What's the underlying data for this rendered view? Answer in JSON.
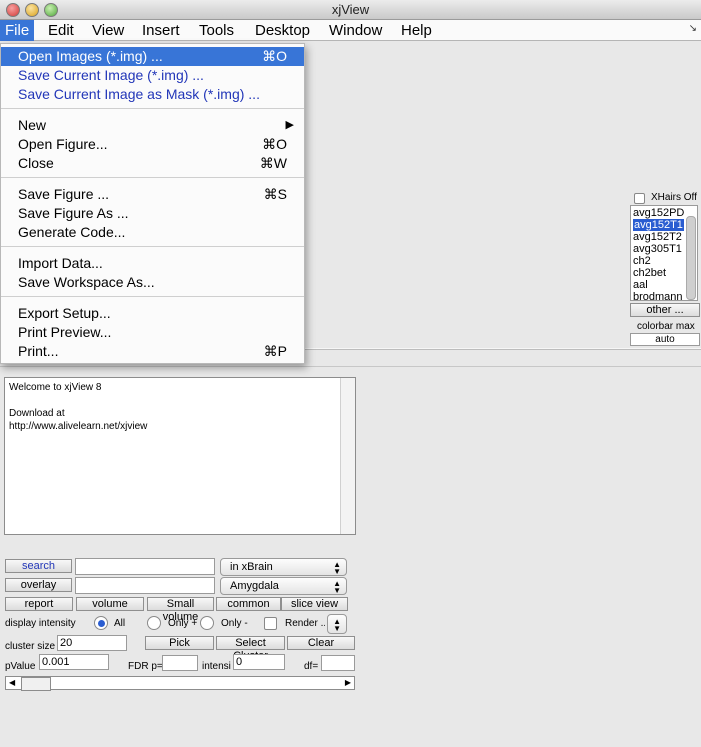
{
  "window": {
    "title": "xjView"
  },
  "menubar": {
    "items": [
      {
        "label": "File",
        "active": true
      },
      {
        "label": "Edit"
      },
      {
        "label": "View"
      },
      {
        "label": "Insert"
      },
      {
        "label": "Tools"
      },
      {
        "label": "Desktop"
      },
      {
        "label": "Window"
      },
      {
        "label": "Help"
      }
    ],
    "resize_glyph": "↘"
  },
  "file_menu": {
    "open_images": {
      "label": "Open Images (*.img) ...",
      "shortcut": "⌘O"
    },
    "save_current_image": {
      "label": "Save Current Image (*.img) ..."
    },
    "save_current_mask": {
      "label": "Save Current Image as Mask (*.img) ..."
    },
    "new": {
      "label": "New",
      "arrow": "▶"
    },
    "open_figure": {
      "label": "Open Figure...",
      "shortcut": "⌘O"
    },
    "close": {
      "label": "Close",
      "shortcut": "⌘W"
    },
    "save_figure": {
      "label": "Save Figure ...",
      "shortcut": "⌘S"
    },
    "save_figure_as": {
      "label": "Save Figure As ..."
    },
    "generate_code": {
      "label": "Generate Code..."
    },
    "import_data": {
      "label": "Import Data..."
    },
    "save_workspace_as": {
      "label": "Save Workspace As..."
    },
    "export_setup": {
      "label": "Export Setup..."
    },
    "print_preview": {
      "label": "Print Preview..."
    },
    "print": {
      "label": "Print...",
      "shortcut": "⌘P"
    }
  },
  "right_panel": {
    "xhairs_label": "XHairs Off",
    "templates": [
      "avg152PD",
      "avg152T1",
      "avg152T2",
      "avg305T1",
      "ch2",
      "ch2bet",
      "aal",
      "brodmann"
    ],
    "selected_template": "avg152T1",
    "other_button": "other ...",
    "colorbar_max_label": "colorbar max",
    "colorbar_max_value": "auto"
  },
  "welcome_text": {
    "line1": "Welcome to xjView 8",
    "line2": "Download at",
    "line3": "http://www.alivelearn.net/xjview"
  },
  "controls": {
    "search_button": "search",
    "search_value": "",
    "search_scope": "in xBrain",
    "overlay_button": "overlay",
    "overlay_value": "",
    "overlay_region": "Amygdala",
    "report_button": "report",
    "volume_button": "volume",
    "small_volume_button": "Small volume",
    "common_region_button": "common reg...",
    "slice_view_button": "slice view",
    "display_intensity_label": "display intensity",
    "radio_all": "All",
    "radio_only_plus": "Only +",
    "radio_only_minus": "Only -",
    "render_label": "Render ...",
    "cluster_size_label": "cluster size",
    "cluster_size_value": "20",
    "pick_cluster_button": "Pick Cluster/...",
    "select_cluster_button": "Select Cluster",
    "clear_select_button": "Clear Select...",
    "pvalue_label": "pValue",
    "pvalue_value": "0.001",
    "fdr_label": "FDR p=",
    "fdr_value": "",
    "intensity_label": "intensi",
    "intensity_value": "0",
    "df_label": "df=",
    "df_value": ""
  }
}
